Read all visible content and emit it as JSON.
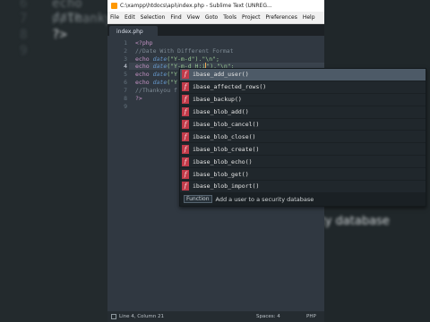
{
  "background": {
    "left_lines": [
      "echo date",
      "//Thanky",
      "?>"
    ],
    "left_line_numbers": [
      "6",
      "7",
      "8",
      "9"
    ],
    "right_tooltip": "ity database"
  },
  "window": {
    "title": "C:\\xampp\\htdocs\\api\\index.php - Sublime Text (UNREG...",
    "menu": [
      "File",
      "Edit",
      "Selection",
      "Find",
      "View",
      "Goto",
      "Tools",
      "Project",
      "Preferences",
      "Help"
    ],
    "tab": "index.php"
  },
  "editor": {
    "line_numbers": [
      "1",
      "2",
      "3",
      "4",
      "5",
      "6",
      "7",
      "8",
      "9"
    ],
    "active_line": "4",
    "lines": {
      "l1": "<?php",
      "l2": "//Date With Different Format",
      "l3_kw": "echo",
      "l3_fn": "date",
      "l3_rest": "(\"Y-m-d\").\"\\n\";",
      "l4_kw": "echo",
      "l4_fn": "date",
      "l4_pre": "(\"Y-m-d H:i",
      "l4_post": "\").\"\\n\";",
      "l5_kw": "echo",
      "l5_fn": "date",
      "l5_rest": "(\"Y",
      "l6_kw": "echo",
      "l6_fn": "date",
      "l6_rest": "(\"Y",
      "l7": "//Thankyou f",
      "l8": "?>"
    }
  },
  "autocomplete": {
    "badge": "f",
    "items": [
      "ibase_add_user()",
      "ibase_affected_rows()",
      "ibase_backup()",
      "ibase_blob_add()",
      "ibase_blob_cancel()",
      "ibase_blob_close()",
      "ibase_blob_create()",
      "ibase_blob_echo()",
      "ibase_blob_get()",
      "ibase_blob_import()"
    ],
    "selected_index": 0,
    "footer_kind": "Function",
    "footer_desc": "Add a user to a security database"
  },
  "statusbar": {
    "position": "Line 4, Column 21",
    "spaces": "Spaces: 4",
    "syntax": "PHP"
  },
  "colors": {
    "editor_bg": "#303841",
    "badge": "#c23b4a",
    "selected_item": "#4d5a67"
  }
}
